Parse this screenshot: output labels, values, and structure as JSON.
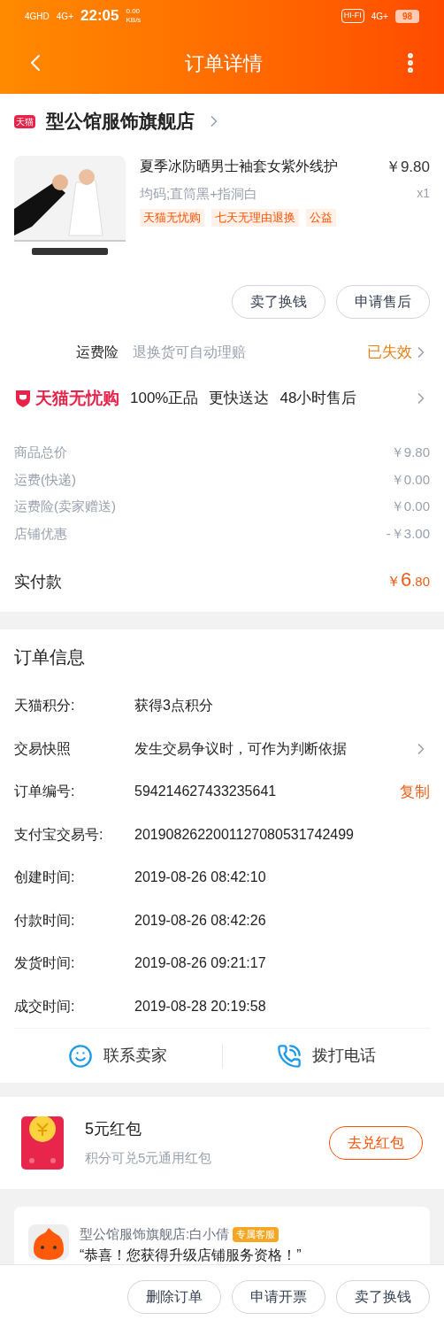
{
  "status_bar": {
    "network_1": "4GHD",
    "network_2": "4G+",
    "time": "22:05",
    "speed": "0.00 KB/s",
    "hifi": "HI-FI",
    "network_3": "4G+",
    "battery": "98"
  },
  "header": {
    "title": "订单详情"
  },
  "store": {
    "name": "型公馆服饰旗舰店",
    "badge": "天猫"
  },
  "product": {
    "title": "夏季冰防晒男士袖套女紫外线护",
    "price": "￥9.80",
    "sku": "均码;直筒黑+指洞白",
    "quantity": "x1",
    "tags": [
      "天猫无忧购",
      "七天无理由退换",
      "公益"
    ]
  },
  "item_actions": [
    "卖了换钱",
    "申请售后"
  ],
  "insurance": {
    "label": "运费险",
    "description": "退换货可自动理赔",
    "status": "已失效"
  },
  "guarantee": {
    "brand": "天猫无忧购",
    "points": [
      "100%正品",
      "更快送达",
      "48小时售后"
    ]
  },
  "price_rows": [
    {
      "label": "商品总价",
      "value": "￥9.80"
    },
    {
      "label": "运费(快递)",
      "value": "￥0.00"
    },
    {
      "label": "运费险(卖家赠送)",
      "value": "￥0.00"
    },
    {
      "label": "店铺优惠",
      "value": "-￥3.00"
    }
  ],
  "paid": {
    "label": "实付款",
    "currency": "￥",
    "integer": "6",
    "decimal": ".80"
  },
  "order_info": {
    "title": "订单信息",
    "rows": [
      {
        "label": "天猫积分:",
        "value": "获得3点积分",
        "kind": "plain"
      },
      {
        "label": "交易快照",
        "value": "发生交易争议时，可作为判断依据",
        "kind": "link"
      },
      {
        "label": "订单编号:",
        "value": "594214627433235641",
        "kind": "copy",
        "action": "复制"
      },
      {
        "label": "支付宝交易号:",
        "value": "2019082622001127080531742499",
        "kind": "plain"
      },
      {
        "label": "创建时间:",
        "value": "2019-08-26 08:42:10",
        "kind": "plain"
      },
      {
        "label": "付款时间:",
        "value": "2019-08-26 08:42:26",
        "kind": "plain"
      },
      {
        "label": "发货时间:",
        "value": "2019-08-26 09:21:17",
        "kind": "plain"
      },
      {
        "label": "成交时间:",
        "value": "2019-08-28 20:19:58",
        "kind": "plain"
      }
    ]
  },
  "contact": [
    "联系卖家",
    "拨打电话"
  ],
  "red_packet": {
    "title": "5元红包",
    "subtitle": "积分可兑5元通用红包",
    "button": "去兑红包"
  },
  "chat": {
    "sender": "型公馆服饰旗舰店:白小倩",
    "badge": "专属客服",
    "message": "“恭喜！您获得升级店铺服务资格！”"
  },
  "bottom_actions": [
    "删除订单",
    "申请开票",
    "卖了换钱"
  ]
}
